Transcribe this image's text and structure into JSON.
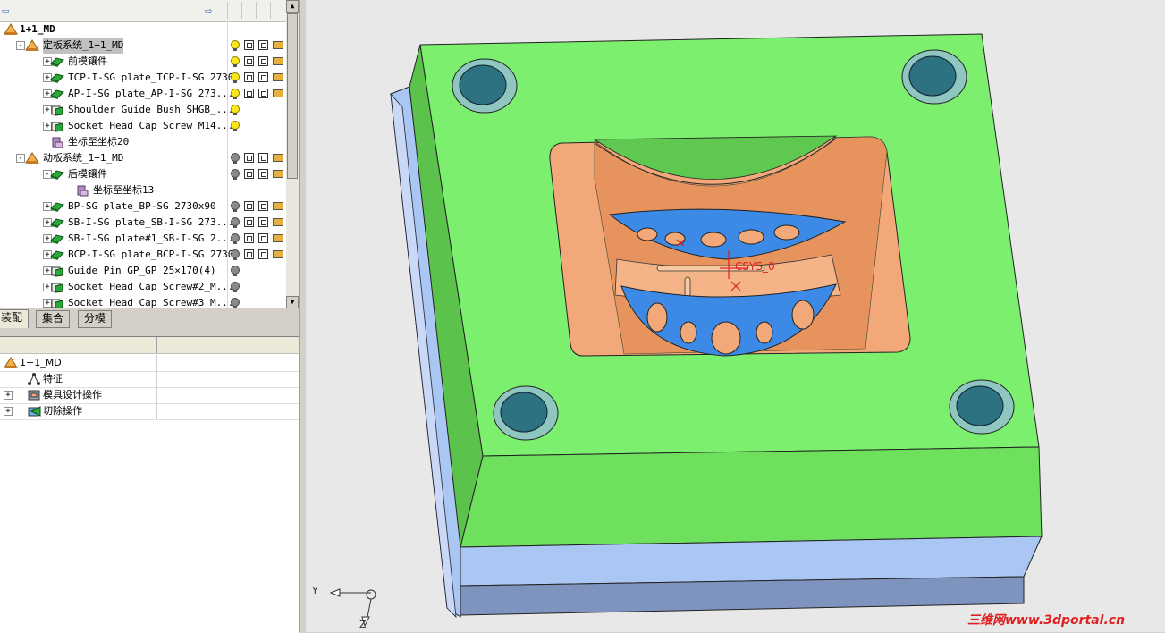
{
  "tree": {
    "root": "1+1_MD",
    "rows": [
      {
        "label": "定板系统_1+1_MD",
        "level": 1,
        "expander": "-",
        "icon": "assembly",
        "selected": true,
        "status": [
          "yellow",
          "sq",
          "sq",
          "pin"
        ]
      },
      {
        "label": "前模镶件",
        "level": 2,
        "expander": "+",
        "icon": "part",
        "status": [
          "yellow",
          "sq",
          "sq",
          "pin"
        ]
      },
      {
        "label": "TCP-I-SG plate_TCP-I-SG 2730",
        "level": 2,
        "expander": "+",
        "icon": "part",
        "status": [
          "yellow",
          "sq",
          "sq",
          "pin"
        ]
      },
      {
        "label": "AP-I-SG plate_AP-I-SG 273...",
        "level": 2,
        "expander": "+",
        "icon": "part",
        "status": [
          "yellow",
          "sq",
          "sq",
          "pin"
        ]
      },
      {
        "label": "Shoulder Guide Bush SHGB_...",
        "level": 2,
        "expander": "+",
        "icon": "component",
        "status": [
          "yellow"
        ]
      },
      {
        "label": "Socket Head Cap Screw_M14...",
        "level": 2,
        "expander": "+",
        "icon": "component",
        "status": [
          "yellow"
        ]
      },
      {
        "label": "坐标至坐标20",
        "level": 2,
        "expander": "",
        "icon": "csys",
        "status": []
      },
      {
        "label": "动板系统_1+1_MD",
        "level": 1,
        "expander": "-",
        "icon": "assembly",
        "status": [
          "gray",
          "sq",
          "sq",
          "pin"
        ]
      },
      {
        "label": "后模镶件",
        "level": 2,
        "expander": "-",
        "icon": "part",
        "status": [
          "gray",
          "sq",
          "sq",
          "pin"
        ]
      },
      {
        "label": "坐标至坐标13",
        "level": 3,
        "expander": "",
        "icon": "csys",
        "status": []
      },
      {
        "label": "BP-SG plate_BP-SG 2730x90",
        "level": 2,
        "expander": "+",
        "icon": "part",
        "status": [
          "gray",
          "sq",
          "sq",
          "pin"
        ]
      },
      {
        "label": "SB-I-SG plate_SB-I-SG 273...",
        "level": 2,
        "expander": "+",
        "icon": "part",
        "status": [
          "gray",
          "sq",
          "sq",
          "pin"
        ]
      },
      {
        "label": "SB-I-SG plate#1_SB-I-SG 2...",
        "level": 2,
        "expander": "+",
        "icon": "part",
        "status": [
          "gray",
          "sq",
          "sq",
          "pin"
        ]
      },
      {
        "label": "BCP-I-SG plate_BCP-I-SG 2730",
        "level": 2,
        "expander": "+",
        "icon": "part",
        "status": [
          "gray",
          "sq",
          "sq",
          "pin"
        ]
      },
      {
        "label": "Guide Pin GP_GP 25×170(4)",
        "level": 2,
        "expander": "+",
        "icon": "component",
        "status": [
          "gray"
        ]
      },
      {
        "label": "Socket Head Cap Screw#2_M...",
        "level": 2,
        "expander": "+",
        "icon": "component",
        "status": [
          "gray"
        ]
      },
      {
        "label": "Socket Head Cap Screw#3 M...",
        "level": 2,
        "expander": "+",
        "icon": "component",
        "status": [
          "gray"
        ]
      }
    ]
  },
  "tabs": [
    {
      "label": "装配",
      "active": true
    },
    {
      "label": "集合",
      "active": false
    },
    {
      "label": "分模",
      "active": false
    }
  ],
  "detail": {
    "rows": [
      {
        "label": "1+1_MD",
        "level": 0,
        "expander": "",
        "icon": "assembly"
      },
      {
        "label": "特征",
        "level": 1,
        "expander": "",
        "icon": "feature"
      },
      {
        "label": "模具设计操作",
        "level": 1,
        "expander": "+",
        "icon": "mold"
      },
      {
        "label": "切除操作",
        "level": 1,
        "expander": "+",
        "icon": "cut"
      }
    ]
  },
  "viewport": {
    "csys_label": "CSYS_0",
    "triad_y": "Y",
    "triad_z": "Z"
  },
  "watermark": "三维网www.3dportal.cn",
  "colors": {
    "plate_green": "#7cf06e",
    "plate_blue": "#aac6f2",
    "cavity_orange": "#f2a878",
    "insert_blue": "#3c8ae6",
    "bushing_teal": "#2c7280"
  }
}
